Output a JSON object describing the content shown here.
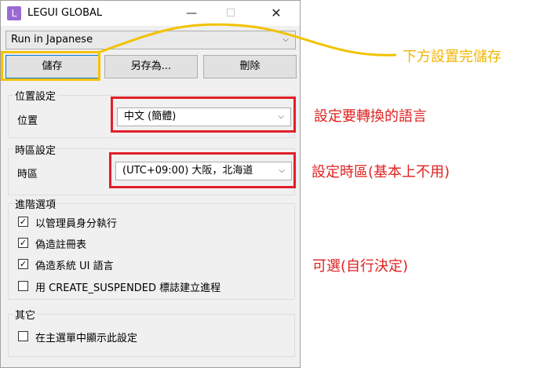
{
  "window": {
    "icon_letter": "L",
    "title": "LEGUI GLOBAL",
    "min_glyph": "—",
    "max_glyph": "☐",
    "close_glyph": "✕"
  },
  "profile": {
    "selected": "Run in Japanese"
  },
  "buttons": {
    "save": "儲存",
    "save_as": "另存為...",
    "delete": "刪除"
  },
  "location_group": {
    "title": "位置設定",
    "label": "位置",
    "value": "中文 (簡體)"
  },
  "timezone_group": {
    "title": "時區設定",
    "label": "時區",
    "value": "(UTC+09:00) 大阪，北海道"
  },
  "advanced_group": {
    "title": "進階選項",
    "options": [
      {
        "label": "以管理員身分執行",
        "checked": true
      },
      {
        "label": "偽造註冊表",
        "checked": true
      },
      {
        "label": "偽造系統 UI 語言",
        "checked": true
      },
      {
        "label": "用 CREATE_SUSPENDED 標誌建立進程",
        "checked": false
      }
    ]
  },
  "other_group": {
    "title": "其它",
    "options": [
      {
        "label": "在主選單中顯示此設定",
        "checked": false
      }
    ]
  },
  "annotations": {
    "save_hint": "下方設置完儲存",
    "language_hint": "設定要轉換的語言",
    "timezone_hint": "設定時區(基本上不用)",
    "optional_hint": "可選(自行決定)"
  },
  "colors": {
    "highlight_yellow": "#f7c200",
    "highlight_red": "#e0202a",
    "app_icon": "#9b6bd3"
  }
}
